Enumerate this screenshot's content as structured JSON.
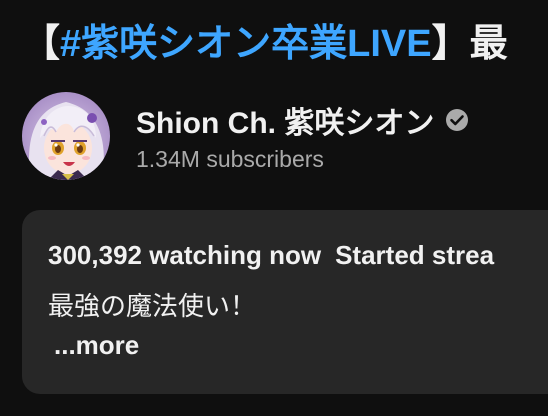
{
  "video": {
    "title_open_bracket": "【",
    "title_hashtag": "#紫咲シオン卒業LIVE",
    "title_close_bracket": "】",
    "title_rest": "最"
  },
  "channel": {
    "name": "Shion Ch. 紫咲シオン",
    "subscribers": "1.34M subscribers",
    "verified_icon": "verified-check-icon",
    "avatar_icon": "channel-avatar"
  },
  "description": {
    "watching": "300,392 watching now",
    "started": "Started strea",
    "text": "最強の魔法使い！",
    "more_label": "...more"
  },
  "colors": {
    "background": "#0f0f0f",
    "hashtag": "#3ea6ff",
    "description_box": "#272727",
    "secondary_text": "#aaaaaa"
  }
}
